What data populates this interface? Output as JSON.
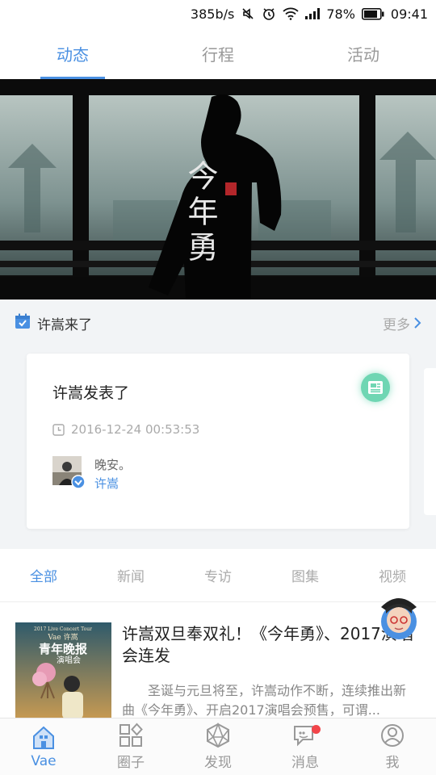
{
  "status_bar": {
    "speed": "385b/s",
    "battery": "78%",
    "time": "09:41"
  },
  "top_tabs": [
    {
      "label": "动态",
      "active": true
    },
    {
      "label": "行程",
      "active": false
    },
    {
      "label": "活动",
      "active": false
    }
  ],
  "banner": {
    "art_text": "今年勇",
    "seal": "许嵩"
  },
  "feed_section": {
    "title": "许嵩来了",
    "more_label": "更多"
  },
  "feed_card": {
    "title": "许嵩发表了",
    "timestamp": "2016-12-24 00:53:53",
    "message": "晚安。",
    "author": "许嵩"
  },
  "category_tabs": [
    {
      "label": "全部",
      "active": true
    },
    {
      "label": "新闻",
      "active": false
    },
    {
      "label": "专访",
      "active": false
    },
    {
      "label": "图集",
      "active": false
    },
    {
      "label": "视频",
      "active": false
    }
  ],
  "article": {
    "title": "许嵩双旦奉双礼！《今年勇》、2017演唱会连发",
    "summary": "圣诞与元旦将至，许嵩动作不断，连续推出新曲《今年勇》、开启2017演唱会预售，可谓...",
    "thumb": {
      "tour": "2017 Live Concert Tour",
      "brand": "Vae 许嵩",
      "name": "青年晚报",
      "sub": "演唱会"
    }
  },
  "bottom_nav": [
    {
      "label": "Vae",
      "icon": "house-icon",
      "active": true
    },
    {
      "label": "圈子",
      "icon": "grid-icon",
      "active": false
    },
    {
      "label": "发现",
      "icon": "polyhedron-icon",
      "active": false
    },
    {
      "label": "消息",
      "icon": "chat-icon",
      "active": false,
      "badge": true
    },
    {
      "label": "我",
      "icon": "person-icon",
      "active": false
    }
  ],
  "colors": {
    "accent": "#4a90e2",
    "badge_green": "#6fd6b3",
    "notify_red": "#f2454a"
  }
}
